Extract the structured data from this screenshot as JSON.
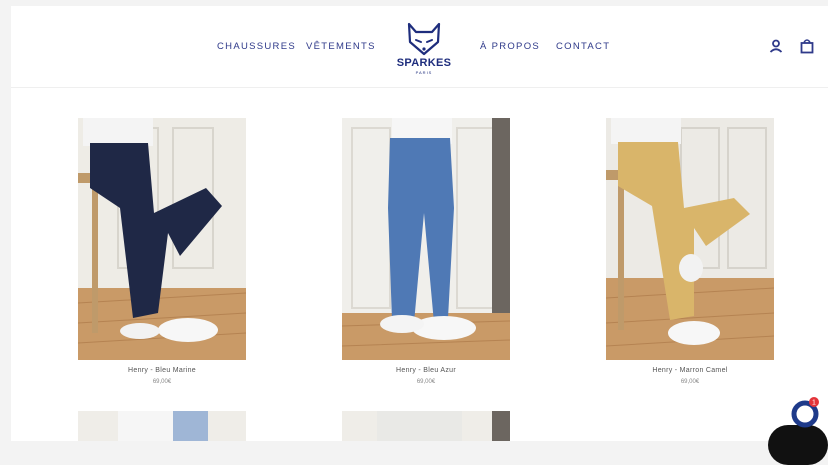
{
  "nav": {
    "left": [
      "CHAUSSURES",
      "VÊTEMENTS"
    ],
    "right": [
      "À PROPOS",
      "CONTACT"
    ]
  },
  "brand": {
    "name": "SPARKES",
    "sub": "PARIS"
  },
  "header_icons": [
    "account-icon",
    "cart-icon"
  ],
  "products": [
    {
      "name": "Henry - Bleu Marine",
      "price": "69,00€",
      "color": "#1f2846"
    },
    {
      "name": "Henry - Bleu Azur",
      "price": "69,00€",
      "color": "#4f79b5"
    },
    {
      "name": "Henry - Marron Camel",
      "price": "69,00€",
      "color": "#d9b56a"
    }
  ],
  "chat": {
    "notification_count": "1",
    "accent": "#1e3a8a",
    "badge_color": "#e3343a"
  }
}
